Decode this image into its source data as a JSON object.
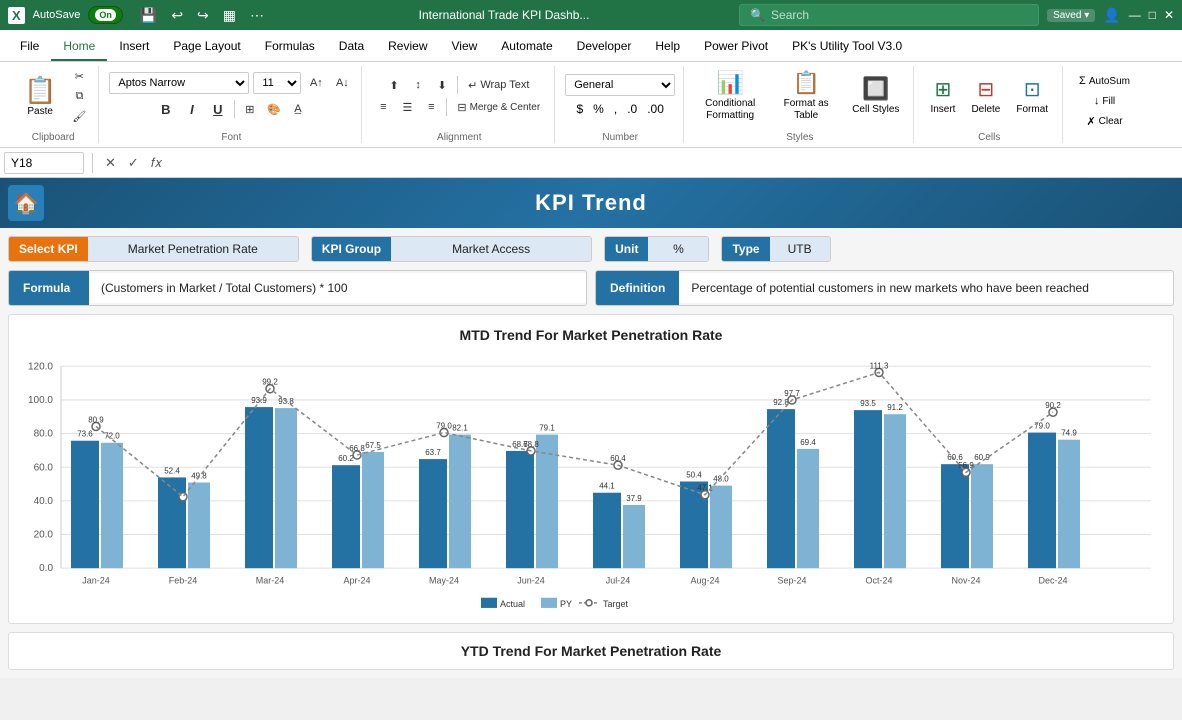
{
  "titlebar": {
    "icon": "X",
    "autosave": "AutoSave",
    "toggle_on": "On",
    "title": "International Trade KPI Dashb...",
    "saved": "Saved",
    "search_placeholder": "Search",
    "user_icon": "👤"
  },
  "ribbon": {
    "tabs": [
      "File",
      "Home",
      "Insert",
      "Page Layout",
      "Formulas",
      "Data",
      "Review",
      "View",
      "Automate",
      "Developer",
      "Help",
      "Power Pivot",
      "PK's Utility Tool V3.0"
    ],
    "active_tab": "Home",
    "clipboard": {
      "paste": "Paste",
      "label": "Clipboard"
    },
    "font": {
      "name": "Aptos Narrow",
      "size": "11",
      "bold": "B",
      "italic": "I",
      "underline": "U",
      "label": "Font"
    },
    "alignment": {
      "wrap_text": "Wrap Text",
      "merge_center": "Merge & Center",
      "label": "Alignment"
    },
    "number": {
      "format": "General",
      "label": "Number"
    },
    "styles": {
      "conditional": "Conditional Formatting",
      "format_as": "Format as Table",
      "cell_styles": "Cell Styles",
      "label": "Styles"
    },
    "cells": {
      "insert": "Insert",
      "delete": "Delete",
      "format": "Format",
      "label": "Cells"
    },
    "editing": {
      "autosum": "AutoSum",
      "fill": "Fill",
      "clear": "Clear",
      "label": "Editing"
    }
  },
  "formula_bar": {
    "cell_ref": "Y18",
    "formula": ""
  },
  "dashboard": {
    "header_title": "KPI Trend",
    "controls": {
      "select_kpi_label": "Select KPI",
      "select_kpi_value": "Market Penetration Rate",
      "kpi_group_label": "KPI Group",
      "kpi_group_value": "Market Access",
      "unit_label": "Unit",
      "unit_value": "%",
      "type_label": "Type",
      "type_value": "UTB"
    },
    "formula": {
      "label": "Formula",
      "value": "(Customers in Market / Total Customers) * 100"
    },
    "definition": {
      "label": "Definition",
      "value": "Percentage of potential customers in new markets who have been reached"
    },
    "chart": {
      "title": "MTD Trend For Market Penetration Rate",
      "legend": {
        "actual": "Actual",
        "py": "PY",
        "target": "Target"
      },
      "months": [
        "Jan-24",
        "Feb-24",
        "Mar-24",
        "Apr-24",
        "May-24",
        "Jun-24",
        "Jul-24",
        "Aug-24",
        "Sep-24",
        "Oct-24",
        "Nov-24",
        "Dec-24"
      ],
      "actual": [
        73.6,
        52.4,
        93.9,
        60.2,
        63.7,
        68.7,
        44.1,
        50.4,
        92.8,
        93.5,
        60.6,
        79.0
      ],
      "py": [
        72.0,
        49.8,
        93.8,
        67.5,
        82.1,
        79.1,
        37.9,
        48.0,
        69.4,
        91.2,
        60.9,
        74.9
      ],
      "target": [
        80.9,
        null,
        99.2,
        66.8,
        79.0,
        68.8,
        60.4,
        47.1,
        97.7,
        111.3,
        56.9,
        90.2
      ],
      "labels_actual": [
        "73.6",
        "52.4",
        "93.9",
        "60.2",
        "63.7",
        "68.7",
        "44.1",
        "50.4",
        "92.8",
        "93.5",
        "60.6",
        "79.0"
      ],
      "labels_py": [
        "72.0",
        "49.8",
        "93.8",
        "67.5",
        "82.1",
        "79.1",
        "37.9",
        "48.0",
        "69.4",
        "91.2",
        "60.9",
        "74.9"
      ],
      "labels_target": [
        "80.9",
        "",
        "99.2",
        "66.8",
        "79.0",
        "68.8",
        "60.4",
        "47.1",
        "97.7",
        "111.3",
        "56.9",
        "90.2"
      ],
      "y_max": 120,
      "y_step": 20
    },
    "ytd": {
      "title": "YTD Trend For Market Penetration Rate"
    }
  }
}
